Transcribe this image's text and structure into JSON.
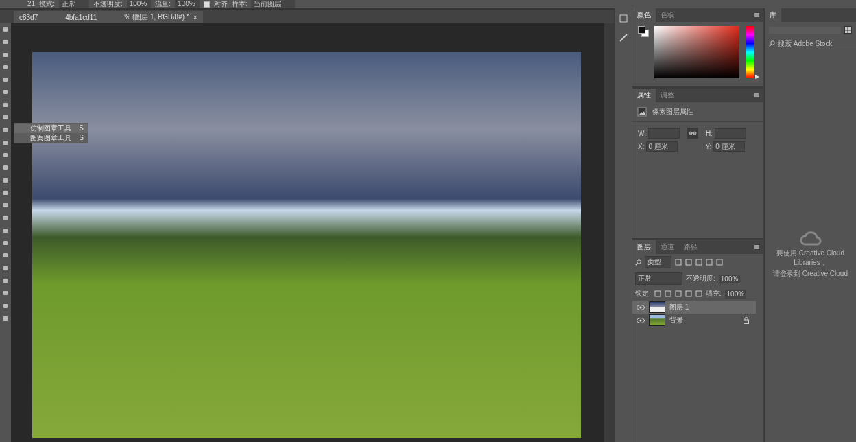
{
  "options_bar": {
    "brush_size": "21",
    "mode_label": "模式:",
    "mode": "正常",
    "opacity_label": "不透明度:",
    "opacity": "100%",
    "flow_label": "流量:",
    "flow": "100%",
    "aligned": {
      "label": "对齐",
      "checked": true
    },
    "sample_label": "样本:",
    "sample": "当前图层"
  },
  "document_tab": {
    "title_parts": [
      "c83d7",
      "4bfa1cd11",
      "% (图层 1, RGB/8#) *"
    ],
    "close": "×"
  },
  "tool_flyout": [
    {
      "label": "仿制图章工具",
      "shortcut": "S",
      "selected": true
    },
    {
      "label": "图案图章工具",
      "shortcut": "S",
      "selected": false
    }
  ],
  "color_panel": {
    "tabs": [
      {
        "label": "颜色",
        "selected": true
      },
      {
        "label": "色板",
        "selected": false
      }
    ],
    "hue_slider": {
      "level": 0.02
    }
  },
  "properties_panel": {
    "tabs": [
      {
        "label": "属性",
        "selected": true
      },
      {
        "label": "调整",
        "selected": false
      }
    ],
    "heading": "像素图层属性",
    "w_label": "W:",
    "h_label": "H:",
    "x_label": "X:",
    "x_value": "0 厘米",
    "y_label": "Y:",
    "y_value": "0 厘米"
  },
  "layers_panel": {
    "tabs": [
      {
        "label": "图层",
        "selected": true
      },
      {
        "label": "通道",
        "selected": false
      },
      {
        "label": "路径",
        "selected": false
      }
    ],
    "filter": "类型",
    "blend_mode": "正常",
    "opacity_label": "不透明度:",
    "opacity": "100%",
    "lock_label": "锁定:",
    "fill_label": "填充:",
    "fill": "100%",
    "layers": [
      {
        "name": "图层 1",
        "selected": true,
        "visible": true,
        "locked": false,
        "kind": "sky"
      },
      {
        "name": "背景",
        "selected": false,
        "visible": true,
        "locked": true,
        "kind": "meadow"
      }
    ]
  },
  "library_panel": {
    "tab": "库",
    "search_placeholder": "搜索 Adobe Stock",
    "message_lines": [
      "要使用 Creative Cloud Libraries，",
      "请登录到 Creative Cloud"
    ]
  }
}
